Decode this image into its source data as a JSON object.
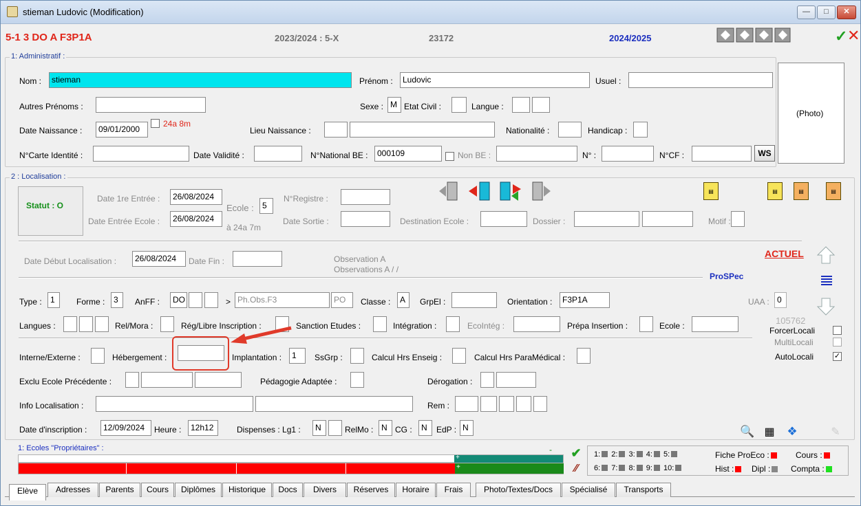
{
  "window": {
    "title": "stieman Ludovic (Modification)",
    "min": "—",
    "max": "□",
    "close": "✕"
  },
  "header": {
    "class_code": "5-1 3 DO  A F3P1A",
    "year_class": "2023/2024 : 5-X",
    "number": "23172",
    "year": "2024/2025",
    "confirm": "✓",
    "cancel": "✕"
  },
  "admin": {
    "title": "1: Administratif :",
    "nom_label": "Nom :",
    "nom": "stieman",
    "prenom_label": "Prénom :",
    "prenom": "Ludovic",
    "usuel_label": "Usuel :",
    "usuel": "",
    "autres_label": "Autres Prénoms :",
    "autres": "",
    "sexe_label": "Sexe :",
    "sexe": "M",
    "etat_label": "Etat Civil :",
    "langue_label": "Langue :",
    "naissance_label": "Date Naissance :",
    "naissance": "09/01/2000",
    "age": "24a 8m",
    "lieu_label": "Lieu Naissance :",
    "nationalite_label": "Nationalité :",
    "handicap_label": "Handicap :",
    "carte_label": "N°Carte Identité :",
    "validite_label": "Date Validité :",
    "national_label": "N°National BE :",
    "national": "000109",
    "nonbe_label": "Non BE :",
    "n_label": "N° :",
    "ncf_label": "N°CF :",
    "ws": "WS",
    "photo": "(Photo)"
  },
  "loc": {
    "title": "2 : Localisation :",
    "statut": "Statut : O",
    "entree1_label": "Date 1re Entrée :",
    "entree1": "26/08/2024",
    "entree_ecole_label": "Date Entrée Ecole :",
    "entree_ecole": "26/08/2024",
    "ecole_label": "Ecole :",
    "ecole": "5",
    "age": "à 24a 7m",
    "registre_label": "N°Registre :",
    "sortie_label": "Date Sortie :",
    "destination_label": "Destination Ecole :",
    "dossier_label": "Dossier :",
    "motif_label": "Motif :",
    "debut_label": "Date Début Localisation :",
    "debut": "26/08/2024",
    "fin_label": "Date Fin :",
    "obsA": "Observation A",
    "obsAs": "Observations A /  /",
    "actuel": "ACTUEL",
    "prospec": "ProSPec",
    "uaa_label": "UAA :",
    "uaa": "0",
    "num": "105762",
    "forcer": "ForcerLocali",
    "multi": "MultiLocali",
    "auto": "AutoLocali",
    "auto_checked": "✓"
  },
  "row_type": {
    "type_label": "Type :",
    "type": "1",
    "forme_label": "Forme :",
    "forme": "3",
    "anff_label": "AnFF :",
    "anff": "DO",
    "arrow": ">",
    "ph": "Ph.Obs.F3",
    "po": "PO",
    "classe_label": "Classe :",
    "classe": "A",
    "grpel_label": "GrpEl :",
    "orientation_label": "Orientation :",
    "orientation": "F3P1A"
  },
  "row_langues": {
    "langues_label": "Langues :",
    "relmora_label": "Rel/Mora :",
    "reglibre_label": "Rég/Libre Inscription :",
    "sanction_label": "Sanction Etudes :",
    "integration_label": "Intégration :",
    "ecointeg_label": "EcoIntég :",
    "prepa_label": "Prépa Insertion :",
    "ecole_label": "Ecole :"
  },
  "row_interne": {
    "interne_label": "Interne/Externe :",
    "hebergement_label": "Hébergement :",
    "implantation_label": "Implantation :",
    "implantation": "1",
    "ssgrp_label": "SsGrp :",
    "calcul_label": "Calcul Hrs Enseig :",
    "calculpm_label": "Calcul Hrs ParaMédical :"
  },
  "row_exclu": {
    "exclu_label": "Exclu Ecole Précédente :",
    "pedagogie_label": "Pédagogie Adaptée :",
    "derogation_label": "Dérogation :"
  },
  "row_info": {
    "info_label": "Info Localisation :",
    "rem_label": "Rem :"
  },
  "row_inscr": {
    "date_label": "Date d'inscription :",
    "date": "12/09/2024",
    "heure_label": "Heure :",
    "heure": "12h12",
    "disp_label": "Dispenses : Lg1 :",
    "lg1": "N",
    "relmo_label": "RelMo :",
    "relmo": "N",
    "cg_label": "CG :",
    "cg": "N",
    "edp_label": "EdP :",
    "edp": "N"
  },
  "ecoles": {
    "title": "1: Ecoles \"Propriétaires\" :",
    "plus1": "+",
    "plus2": "+",
    "dash": "-"
  },
  "legend": {
    "row1": [
      "1:",
      "2:",
      "3:",
      "4:",
      "5:"
    ],
    "row2": [
      "6:",
      "7:",
      "8:",
      "9:",
      "10:"
    ],
    "fiche": "Fiche ProEco :",
    "cours": "Cours :",
    "hist": "Hist :",
    "dipl": "Dipl :",
    "compta": "Compta :"
  },
  "tabs": [
    "Elève",
    "Adresses",
    "Parents",
    "Cours",
    "Diplômes",
    "Historique",
    "Docs",
    "Divers",
    "Réserves",
    "Horaire",
    "Frais",
    "Photo/Textes/Docs",
    "Spécialisé",
    "Transports"
  ],
  "colors": {
    "accent_red": "#ff0000",
    "blue": "#1b2fbf",
    "cyan": "#00e5ee",
    "green": "#1a8a1a",
    "teal": "#138a76"
  }
}
